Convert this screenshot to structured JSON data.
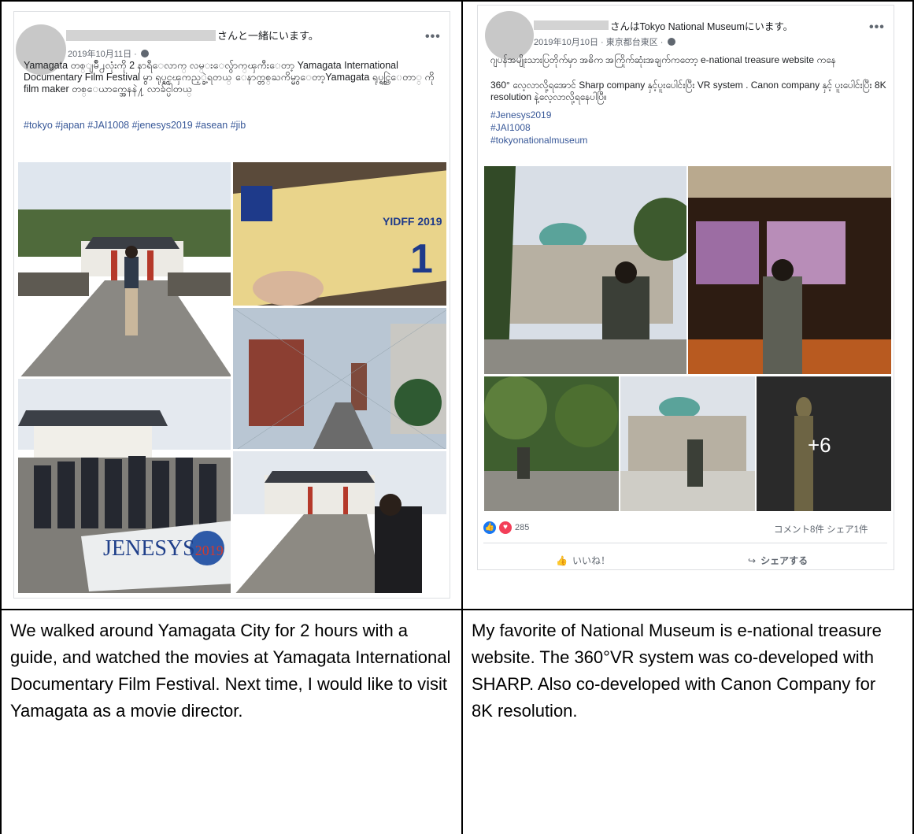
{
  "left_post": {
    "header_suffix": "さんと一緒にいます。",
    "date": "2019年10月11日 ·",
    "body": "Yamagata တစ္ျမိဳ႕လုံးကို 2 နာရီေလာက္ လမ္းေလွ်ာက္ၾကီးေတာ့ Yamagata International Documentary Film Festival မွာ ရုပ္ရွင္ၾကည့္ခဲ့ရတယ္ ေနာက္တစ္ႀကိမ္မွာေတာ့Yamagata ရုပ္ရွင္ပြဲေတာ္ ကို film maker တစ္ေယာက္အေနနဲ႔ လာခ်င္ပါတယ္",
    "hashtags": "#tokyo #japan #JAI1008 #jenesys2019 #asean #jib",
    "more": "•••",
    "photos": {
      "ticket_label": "YIDFF 2019",
      "ticket_number": "1",
      "banner_text": "JENESYS",
      "banner_year": "2019"
    }
  },
  "right_post": {
    "header": "さんはTokyo National Museumにいます。",
    "date": "2019年10月10日 · 東京都台東区 ·",
    "line1": "ဂျပန်အမျိုးသားပြတိုက်မှာ အဓိက အကြိုက်ဆုံးအချက်ကတော့ e-national treasure website ကနေ",
    "line2": "360° လေ့လာလို့ရအောင် Sharp company နှင့်ပူးပေါင်းပြီး VR system . Canon company နှင့် ပူးပေါင်းပြီး 8K resolution နဲ့လေ့လာလို့ရနေပါပြီ။",
    "tags": [
      "#Jenesys2019",
      "#JAI1008",
      "#tokyonationalmuseum"
    ],
    "more": "•••",
    "plus_count": "+6",
    "reactions": "285",
    "comments_shares": "コメント8件 シェア1件",
    "like_label": "いいね！",
    "share_label": "シェアする"
  },
  "captions": {
    "left": "We walked around Yamagata City for 2 hours with a guide, and watched the movies at Yamagata International Documentary Film Festival. Next time, I would like to visit Yamagata as a movie director.",
    "right": "My favorite of National Museum is e-national treasure website. The 360°VR system was co-developed with SHARP. Also co-developed with Canon Company for 8K resolution."
  },
  "colors": {
    "link": "#385898",
    "like_blue": "#1877f2",
    "love_red": "#f33e58"
  }
}
